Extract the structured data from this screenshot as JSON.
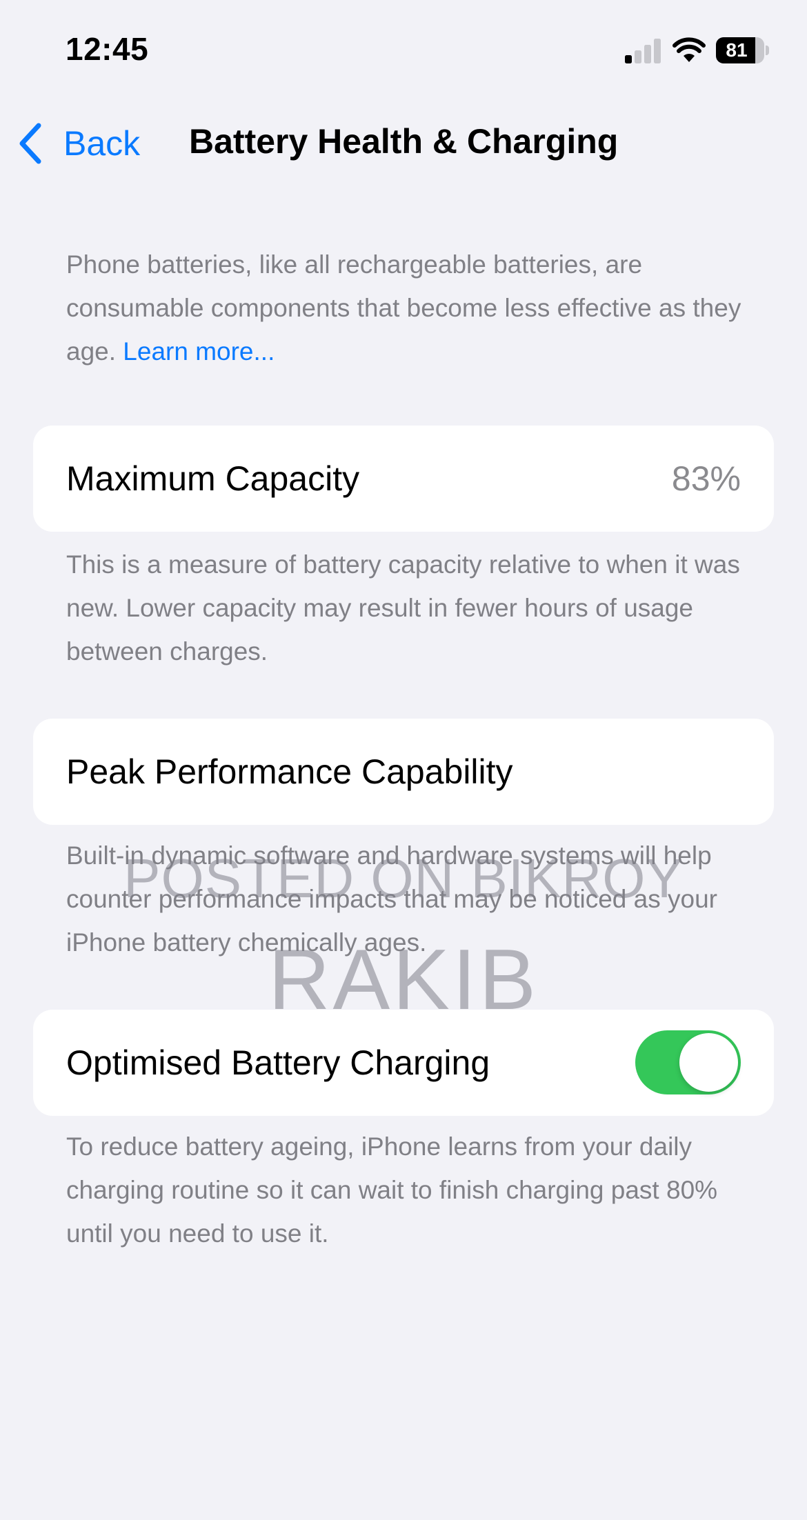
{
  "status_bar": {
    "time": "12:45",
    "battery_level": "81",
    "battery_fraction": 0.81,
    "signal_bars_active": 1,
    "signal_bars_total": 4
  },
  "nav": {
    "back_label": "Back",
    "title": "Battery Health & Charging"
  },
  "intro": {
    "text": "Phone batteries, like all rechargeable batteries, are consumable components that become less effective as they age. ",
    "link": "Learn more..."
  },
  "maximum_capacity": {
    "label": "Maximum Capacity",
    "value": "83%",
    "description": "This is a measure of battery capacity relative to when it was new. Lower capacity may result in fewer hours of usage between charges."
  },
  "peak_performance": {
    "label": "Peak Performance Capability",
    "description": "Built-in dynamic software and hardware systems will help counter performance impacts that may be noticed as your iPhone battery chemically ages."
  },
  "optimised_charging": {
    "label": "Optimised Battery Charging",
    "enabled": true,
    "description": "To reduce battery ageing, iPhone learns from your daily charging routine so it can wait to finish charging past 80% until you need to use it."
  },
  "watermark": {
    "line1": "POSTED ON BIKROY",
    "line2": "RAKIB"
  },
  "colors": {
    "accent": "#0a7aff",
    "toggle_on": "#34c759",
    "background": "#f2f2f7",
    "secondary_text": "#808086"
  },
  "icons": {
    "signal": "cellular-signal-icon",
    "wifi": "wifi-icon",
    "battery": "battery-icon",
    "back": "chevron-left-icon"
  }
}
